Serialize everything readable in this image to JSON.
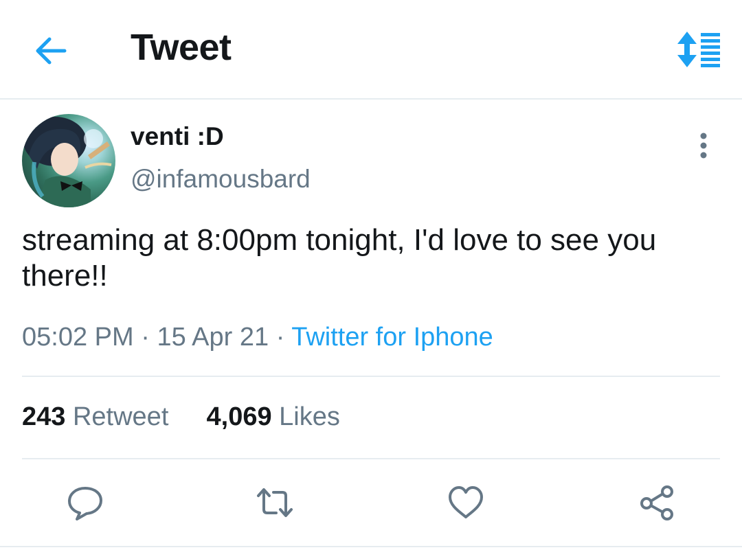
{
  "header": {
    "title": "Tweet",
    "back_icon": "arrow-left-icon",
    "sort_icon": "sort-list-icon",
    "accent_color": "#1da1f2"
  },
  "tweet": {
    "display_name": "venti :D",
    "handle": "@infamousbard",
    "text": "streaming at 8:00pm tonight, I'd love to see you there!!",
    "time": "05:02 PM",
    "separator": "·",
    "date": "15 Apr 21",
    "source": "Twitter for Iphone",
    "more_icon": "more-vertical-icon"
  },
  "stats": {
    "retweets_count": "243",
    "retweets_label": "Retweet",
    "likes_count": "4,069",
    "likes_label": "Likes"
  },
  "actions": [
    {
      "icon": "reply-icon"
    },
    {
      "icon": "retweet-icon"
    },
    {
      "icon": "like-icon"
    },
    {
      "icon": "share-icon"
    }
  ],
  "colors": {
    "text": "#14171a",
    "secondary": "#657786",
    "link": "#1da1f2",
    "divider": "#e6ecf0"
  }
}
